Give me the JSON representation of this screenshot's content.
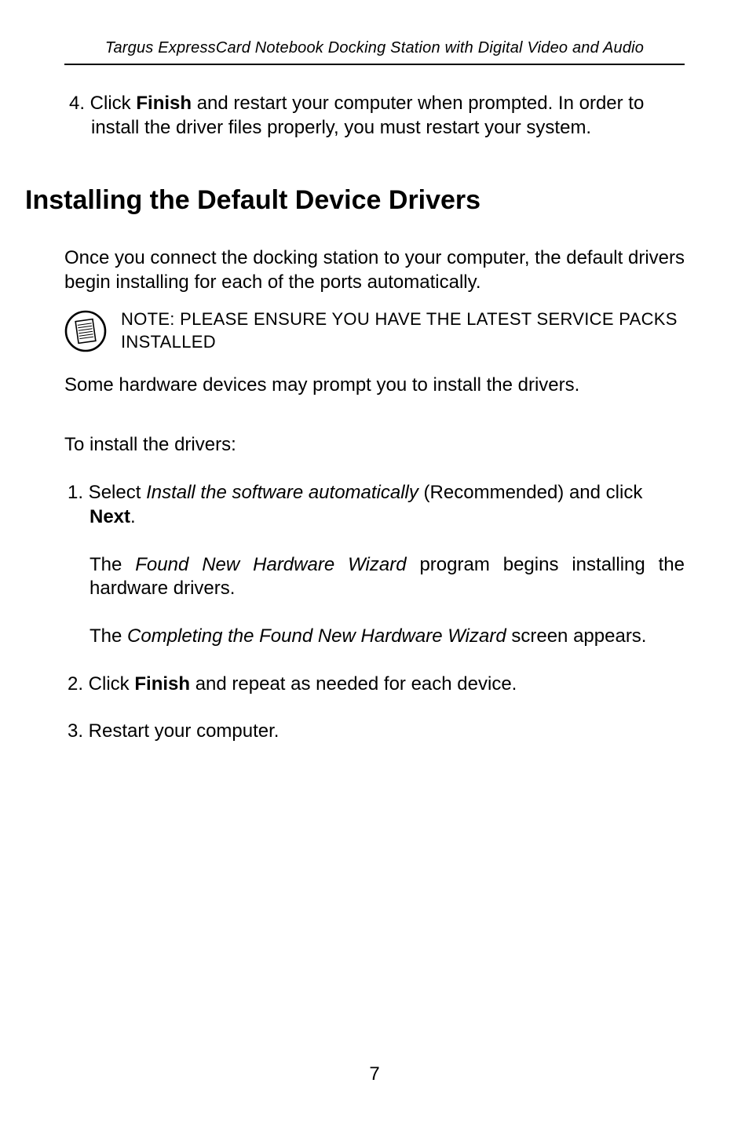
{
  "header": {
    "running_title": "Targus ExpressCard Notebook Docking Station with Digital Video and Audio"
  },
  "prior_section": {
    "step4_pre": "4. Click ",
    "step4_bold": "Finish",
    "step4_post": " and restart your computer when prompted. In order to install the driver files properly, you must restart your system."
  },
  "section": {
    "title": "Installing the Default Device Drivers",
    "intro": "Once you connect the docking station to your computer, the default drivers begin installing for each of the ports automatically.",
    "note": "NOTE: PLEASE ENSURE YOU HAVE THE LATEST SERVICE PACKS INSTALLED",
    "some_hw": "Some hardware devices may prompt you to install the drivers.",
    "to_install": "To install the drivers:",
    "s1_pre": "1. Select ",
    "s1_italic": "Install the software automatically",
    "s1_mid": " (Recommended) and click ",
    "s1_bold": "Next",
    "s1_post": ".",
    "s1_p2_pre": "The ",
    "s1_p2_italic": "Found New Hardware Wizard",
    "s1_p2_post": " program begins installing the hardware drivers.",
    "s1_p3_pre": "The ",
    "s1_p3_italic": "Completing the Found New Hardware Wizard",
    "s1_p3_post": " screen appears.",
    "s2_pre": "2. Click ",
    "s2_bold": "Finish",
    "s2_post": " and repeat as needed for each device.",
    "s3": "3. Restart your computer."
  },
  "page_number": "7"
}
